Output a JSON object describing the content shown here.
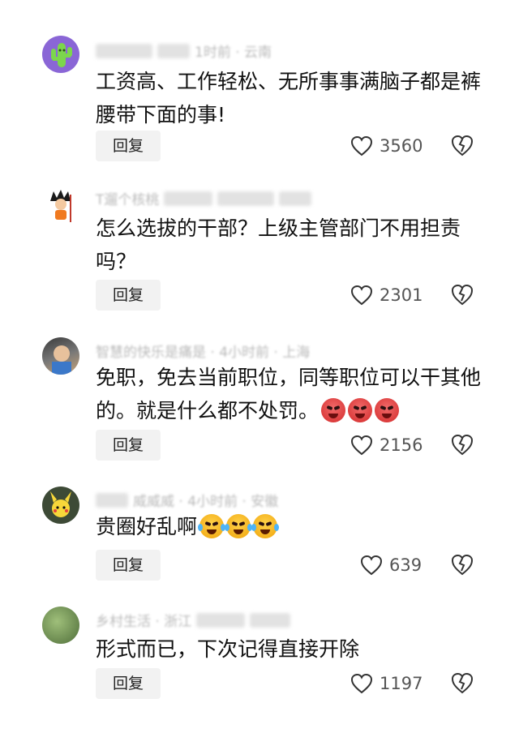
{
  "comments": [
    {
      "avatar": "cactus-avatar",
      "meta_fragment": "1时前 · 云南",
      "content": "工资高、工作轻松、无所事事满脑子都是裤腰带下面的事!",
      "reply_label": "回复",
      "likes": "3560"
    },
    {
      "avatar": "cartoon-boy-avatar",
      "meta_fragment": "T遛个核桃",
      "content": "怎么选拔的干部？上级主管部门不用担责吗？",
      "reply_label": "回复",
      "likes": "2301"
    },
    {
      "avatar": "child-photo-avatar",
      "meta_fragment": "智慧的快乐是痛是 · 4小时前 · 上海",
      "content": "免职，免去当前职位，同等职位可以干其他的。就是什么都不处罚。",
      "reply_label": "回复",
      "likes": "2156",
      "emoji": "angry-emoji"
    },
    {
      "avatar": "pikachu-avatar",
      "meta_fragment": "威威威 · 4小时前 · 安徽",
      "content": "贵圈好乱啊",
      "reply_label": "回复",
      "likes": "639",
      "emoji": "laugh-cry-emoji"
    },
    {
      "avatar": "nature-avatar",
      "meta_fragment": "乡村生活 · 浙江",
      "content": "形式而已，下次记得直接开除",
      "reply_label": "回复",
      "likes": "1197"
    }
  ],
  "icons": {
    "like": "heart-icon",
    "dislike": "broken-heart-icon"
  },
  "colors": {
    "reply_bg": "#f2f2f2",
    "text": "#111111",
    "muted": "#555555"
  }
}
